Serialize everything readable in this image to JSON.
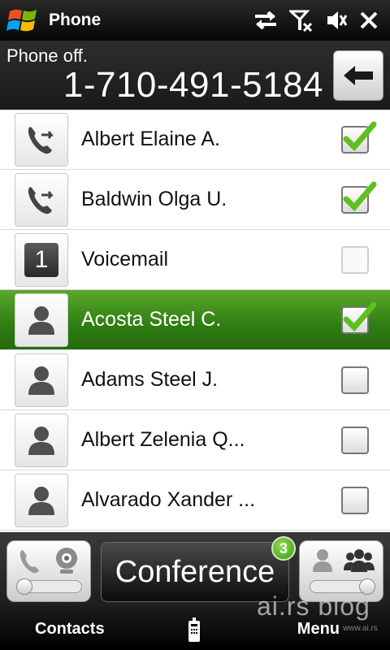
{
  "status_bar": {
    "title": "Phone",
    "icons": [
      "windows-start-icon",
      "sync-icon",
      "no-signal-icon",
      "speaker-muted-icon",
      "close-icon"
    ]
  },
  "dial": {
    "status": "Phone off.",
    "number": "1-710-491-5184",
    "backspace_icon": "backspace-arrow-icon"
  },
  "contacts": [
    {
      "name": "Albert Elaine A.",
      "icon": "call-forward-icon",
      "checked": true,
      "selected": false
    },
    {
      "name": "Baldwin Olga U.",
      "icon": "call-forward-icon",
      "checked": true,
      "selected": false
    },
    {
      "name": "Voicemail",
      "icon": "speed-dial-1-icon",
      "checked": false,
      "selected": false
    },
    {
      "name": "Acosta Steel C.",
      "icon": "contact-person-icon",
      "checked": true,
      "selected": true
    },
    {
      "name": "Adams Steel J.",
      "icon": "contact-person-icon",
      "checked": false,
      "selected": false
    },
    {
      "name": "Albert Zelenia Q...",
      "icon": "contact-person-icon",
      "checked": false,
      "selected": false
    },
    {
      "name": "Alvarado Xander ...",
      "icon": "contact-person-icon",
      "checked": false,
      "selected": false
    }
  ],
  "voicemail_key": "1",
  "controls": {
    "conference_label": "Conference",
    "conference_badge": "3",
    "left_toggle_icons": [
      "phone-icon",
      "webcam-icon"
    ],
    "right_toggle_icons": [
      "single-person-icon",
      "group-icon"
    ]
  },
  "softkeys": {
    "left": "Contacts",
    "right": "Menu"
  },
  "watermark": {
    "main": "ai.rs blog",
    "small": "www.ai.rs"
  }
}
